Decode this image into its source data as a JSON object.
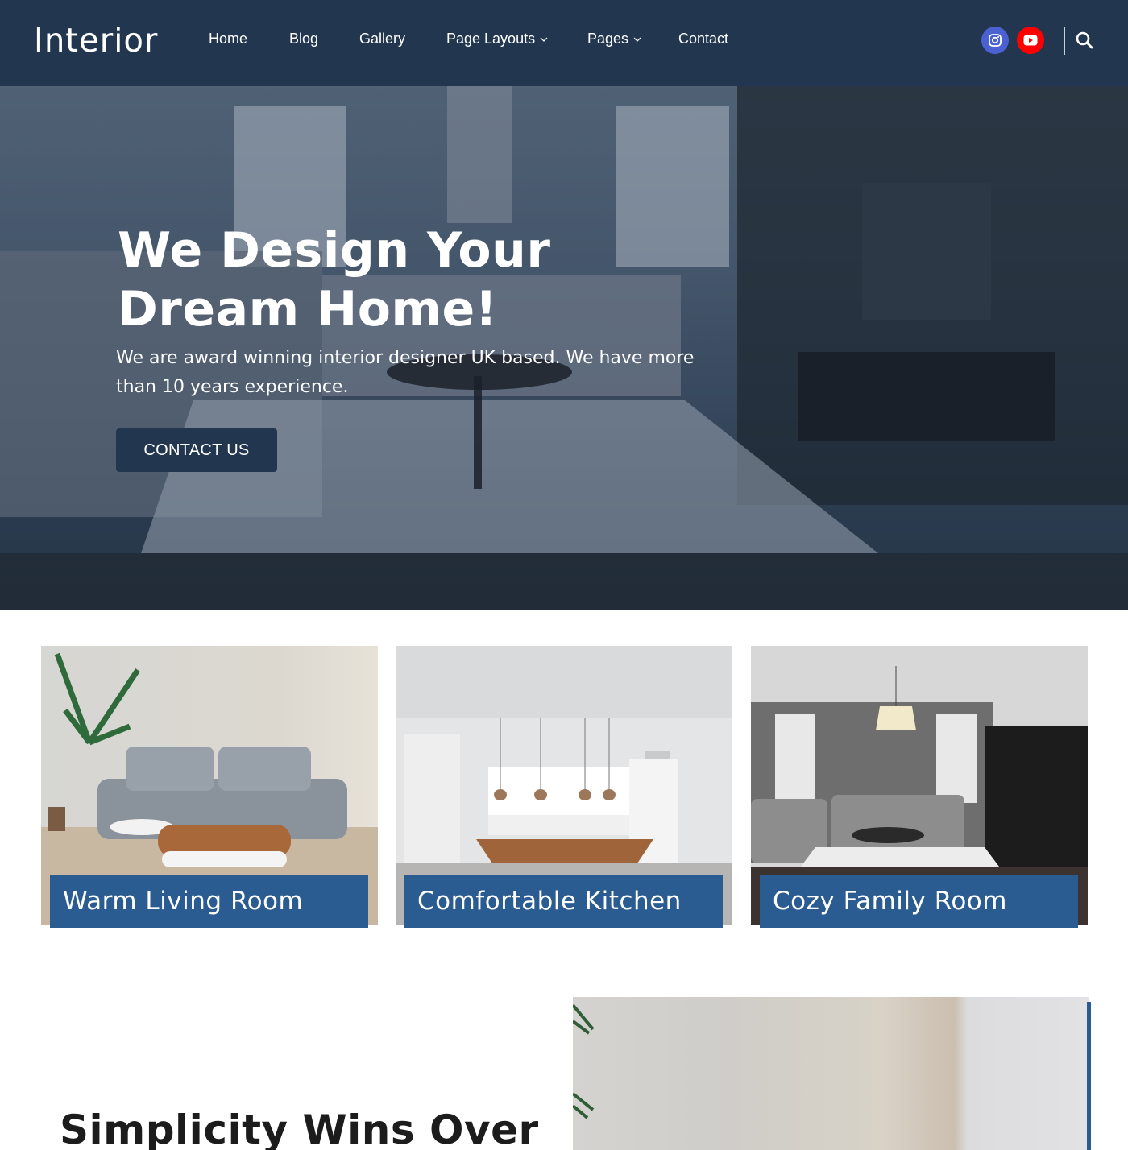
{
  "header": {
    "logo": "Interior",
    "nav": [
      {
        "label": "Home",
        "has_dropdown": false
      },
      {
        "label": "Blog",
        "has_dropdown": false
      },
      {
        "label": "Gallery",
        "has_dropdown": false
      },
      {
        "label": "Page Layouts",
        "has_dropdown": true
      },
      {
        "label": "Pages",
        "has_dropdown": true
      },
      {
        "label": "Contact",
        "has_dropdown": false
      }
    ],
    "social": [
      {
        "name": "instagram-icon",
        "color": "#4b61d1"
      },
      {
        "name": "youtube-icon",
        "color": "#ff0000"
      }
    ],
    "search_icon": "search-icon",
    "background": "#22374f"
  },
  "hero": {
    "title": "We Design Your Dream Home!",
    "subtitle": "We are award winning interior designer UK based. We have more than 10 years experience.",
    "cta_label": "CONTACT US"
  },
  "cards": [
    {
      "title": "Warm Living Room"
    },
    {
      "title": "Comfortable Kitchen"
    },
    {
      "title": "Cozy Family Room"
    }
  ],
  "section": {
    "title": "Simplicity Wins Over"
  },
  "colors": {
    "primary_dark": "#22374f",
    "accent_blue": "#2b5c91"
  }
}
